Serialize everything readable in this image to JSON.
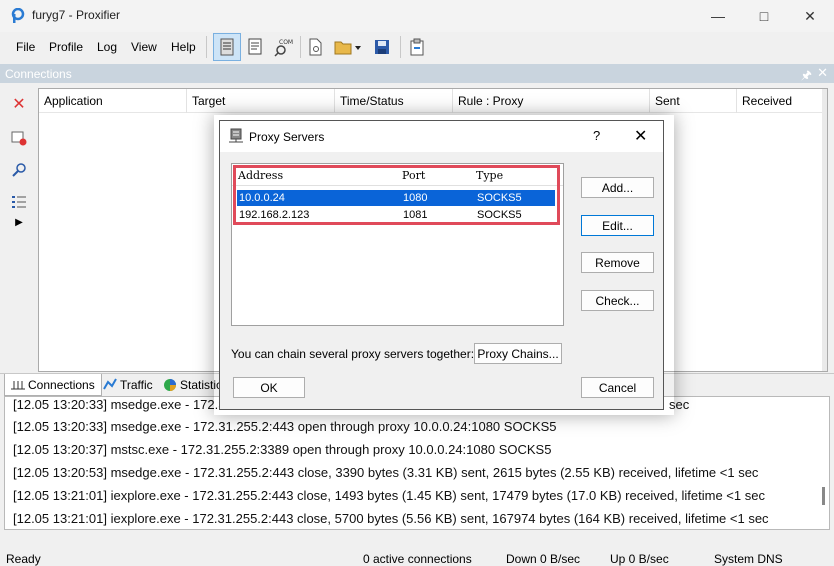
{
  "window": {
    "title": "furyg7 - Proxifier",
    "min": "—",
    "max": "□",
    "close": "✕"
  },
  "menu": [
    "File",
    "Profile",
    "Log",
    "View",
    "Help"
  ],
  "connections_panel": {
    "header": "Connections",
    "columns": [
      "Application",
      "Target",
      "Time/Status",
      "Rule : Proxy",
      "Sent",
      "Received"
    ]
  },
  "tabs": [
    "Connections",
    "Traffic",
    "Statistics"
  ],
  "log": [
    "[12.05 13:20:33] msedge.exe - 172.31.255.2:443 open through proxy 10.0.0.24:1080 SOCKS5",
    "[12.05 13:20:37] mstsc.exe - 172.31.255.2:3389 open through proxy 10.0.0.24:1080 SOCKS5",
    "[12.05 13:20:53] msedge.exe - 172.31.255.2:443 close, 3390 bytes (3.31 KB) sent, 2615 bytes (2.55 KB) received, lifetime <1 sec",
    "[12.05 13:21:01] iexplore.exe - 172.31.255.2:443 close, 1493 bytes (1.45 KB) sent, 17479 bytes (17.0 KB) received, lifetime <1 sec",
    "[12.05 13:21:01] iexplore.exe - 172.31.255.2:443 close, 5700 bytes (5.56 KB) sent, 167974 bytes (164 KB) received, lifetime <1 sec"
  ],
  "log_partial_top": "[12.05 13:20:33] msedge.exe - 172.3",
  "log_partial_right": "sec",
  "status": {
    "ready": "Ready",
    "connections": "0 active connections",
    "down": "Down 0 B/sec",
    "up": "Up 0 B/sec",
    "dns": "System DNS"
  },
  "dialog": {
    "title": "Proxy Servers",
    "help": "?",
    "close": "✕",
    "columns": {
      "address": "Address",
      "port": "Port",
      "type": "Type"
    },
    "rows": [
      {
        "address": "10.0.0.24",
        "port": "1080",
        "type": "SOCKS5"
      },
      {
        "address": "192.168.2.123",
        "port": "1081",
        "type": "SOCKS5"
      }
    ],
    "buttons": {
      "add": "Add...",
      "edit": "Edit...",
      "remove": "Remove",
      "check": "Check...",
      "chains": "Proxy Chains...",
      "ok": "OK",
      "cancel": "Cancel"
    },
    "chain_text": "You can chain several proxy servers together:"
  },
  "colors": {
    "selection": "#0a64d8",
    "annotation": "#e04a5a",
    "panel_header": "#c9d4de"
  }
}
